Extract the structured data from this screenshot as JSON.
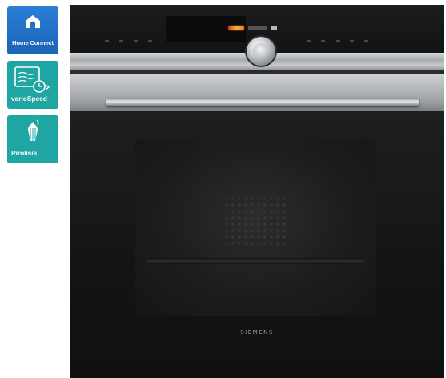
{
  "badges": [
    {
      "label": "Home Connect",
      "icon": "home-connect-icon",
      "color": "#1f6fc8"
    },
    {
      "label": "varioSpeed",
      "icon": "variospeed-icon",
      "color": "#1fa5a2"
    },
    {
      "label": "Pirólisis",
      "icon": "pyrolysis-icon",
      "color": "#1fa5a2"
    }
  ],
  "oven": {
    "brand": "SIEMENS"
  }
}
